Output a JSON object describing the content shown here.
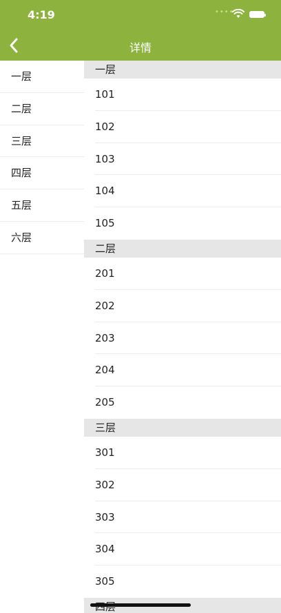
{
  "status": {
    "time": "4:19",
    "signal_dots": "••••"
  },
  "nav": {
    "title": "详情",
    "back_icon": "chevron-left-icon"
  },
  "sidebar": {
    "items": [
      {
        "label": "一层"
      },
      {
        "label": "二层"
      },
      {
        "label": "三层"
      },
      {
        "label": "四层"
      },
      {
        "label": "五层"
      },
      {
        "label": "六层"
      }
    ]
  },
  "sections": [
    {
      "title": "一层",
      "rooms": [
        "101",
        "102",
        "103",
        "104",
        "105"
      ]
    },
    {
      "title": "二层",
      "rooms": [
        "201",
        "202",
        "203",
        "204",
        "205"
      ]
    },
    {
      "title": "三层",
      "rooms": [
        "301",
        "302",
        "303",
        "304",
        "305"
      ]
    },
    {
      "title": "四层",
      "rooms": []
    }
  ],
  "colors": {
    "brand": "#8db33e",
    "section_bg": "#e6e6e6",
    "divider": "#ececec"
  }
}
